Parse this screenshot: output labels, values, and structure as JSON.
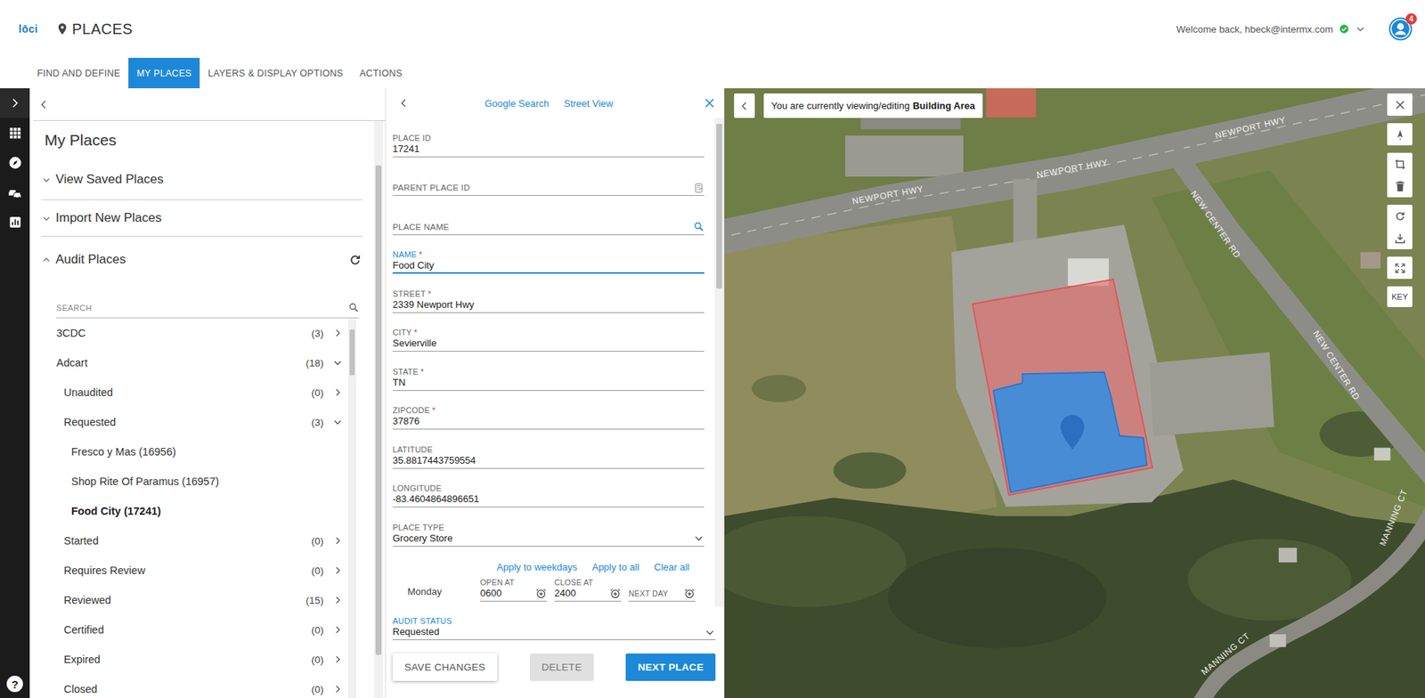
{
  "header": {
    "logo": "lōci",
    "title": "PLACES",
    "welcome": "Welcome back, hbeck@intermx.com",
    "verified": true,
    "notifications": "4"
  },
  "tabs": [
    {
      "label": "FIND AND DEFINE",
      "selected": false
    },
    {
      "label": "MY PLACES",
      "selected": true
    },
    {
      "label": "LAYERS & DISPLAY OPTIONS",
      "selected": false
    },
    {
      "label": "ACTIONS",
      "selected": false
    }
  ],
  "rail": {
    "help": "?"
  },
  "my_places": {
    "title": "My Places",
    "sections": [
      {
        "label": "View Saved Places",
        "expanded": false
      },
      {
        "label": "Import New Places",
        "expanded": false
      },
      {
        "label": "Audit Places",
        "expanded": true
      }
    ],
    "search": {
      "placeholder": "SEARCH"
    },
    "tree": [
      {
        "label": "3CDC",
        "count": "(3)",
        "kind": "group",
        "expanded": false,
        "selected": false
      },
      {
        "label": "Adcart",
        "count": "(18)",
        "kind": "group",
        "expanded": true,
        "selected": false
      },
      {
        "label": "Unaudited",
        "count": "(0)",
        "kind": "status",
        "expanded": false,
        "selected": false
      },
      {
        "label": "Requested",
        "count": "(3)",
        "kind": "status",
        "expanded": true,
        "selected": false
      },
      {
        "label": "Fresco y Mas (16956)",
        "kind": "place",
        "selected": false
      },
      {
        "label": "Shop Rite Of Paramus (16957)",
        "kind": "place",
        "selected": false
      },
      {
        "label": "Food City (17241)",
        "kind": "place",
        "selected": true
      },
      {
        "label": "Started",
        "count": "(0)",
        "kind": "status",
        "expanded": false,
        "selected": false
      },
      {
        "label": "Requires Review",
        "count": "(0)",
        "kind": "status",
        "expanded": false,
        "selected": false
      },
      {
        "label": "Reviewed",
        "count": "(15)",
        "kind": "status",
        "expanded": false,
        "selected": false
      },
      {
        "label": "Certified",
        "count": "(0)",
        "kind": "status",
        "expanded": false,
        "selected": false
      },
      {
        "label": "Expired",
        "count": "(0)",
        "kind": "status",
        "expanded": false,
        "selected": false
      },
      {
        "label": "Closed",
        "count": "(0)",
        "kind": "status",
        "expanded": false,
        "selected": false
      }
    ]
  },
  "place_form": {
    "links": [
      "Google Search",
      "Street View"
    ],
    "required_mark": "*",
    "fields": [
      {
        "label": "PLACE ID",
        "value": "17241",
        "kind": "text",
        "required": false,
        "focused": false
      },
      {
        "label": "PARENT PLACE ID",
        "value": "",
        "kind": "lookup",
        "required": false,
        "focused": false
      },
      {
        "label": "PLACE NAME",
        "value": "",
        "kind": "search",
        "required": false,
        "focused": false
      },
      {
        "label": "NAME",
        "value": "Food City",
        "kind": "text",
        "required": true,
        "focused": true
      },
      {
        "label": "STREET",
        "value": "2339 Newport Hwy",
        "kind": "text",
        "required": true,
        "focused": false
      },
      {
        "label": "CITY",
        "value": "Sevierville",
        "kind": "text",
        "required": true,
        "focused": false
      },
      {
        "label": "STATE",
        "value": "TN",
        "kind": "text",
        "required": true,
        "focused": false
      },
      {
        "label": "ZIPCODE",
        "value": "37876",
        "kind": "text",
        "required": true,
        "focused": false
      },
      {
        "label": "LATITUDE",
        "value": "35.8817443759554",
        "kind": "text",
        "required": false,
        "focused": false
      },
      {
        "label": "LONGITUDE",
        "value": "-83.4604864896651",
        "kind": "text",
        "required": false,
        "focused": false
      },
      {
        "label": "PLACE TYPE",
        "value": "Grocery Store",
        "kind": "select",
        "required": false,
        "focused": false
      }
    ],
    "hours": {
      "links": [
        "Apply to weekdays",
        "Apply to all",
        "Clear all"
      ],
      "days": [
        {
          "day": "Monday",
          "open_label": "OPEN AT",
          "open": "0600",
          "close_label": "CLOSE AT",
          "close": "2400",
          "next_label": "NEXT DAY",
          "next": ""
        }
      ]
    },
    "audit_status": {
      "label": "AUDIT STATUS",
      "value": "Requested",
      "focused": true
    },
    "buttons": [
      {
        "label": "SAVE CHANGES",
        "kind": "outline",
        "disabled": false
      },
      {
        "label": "DELETE",
        "kind": "flat",
        "disabled": true
      },
      {
        "label": "NEXT PLACE",
        "kind": "primary",
        "disabled": false
      }
    ]
  },
  "map": {
    "banner_prefix": "You are currently viewing/editing",
    "banner_layer": "Building Area",
    "key": "KEY",
    "road_labels": [
      "NEWPORT HWY",
      "NEWPORT HWY",
      "NEWPORT HWY",
      "NEW CENTER RD",
      "NEW CENTER RD",
      "MANNING CT",
      "MANNING CT"
    ]
  }
}
